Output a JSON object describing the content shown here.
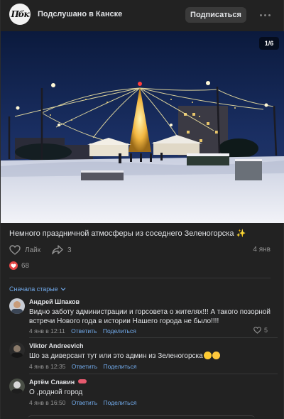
{
  "header": {
    "avatar_text": "Пбк",
    "title": "Подслушано в Канске",
    "subscribe_label": "Подписаться"
  },
  "photo": {
    "counter": "1/6"
  },
  "post": {
    "text": "Немного праздничной атмосферы из соседнего Зеленогорска ✨",
    "like_label": "Лайк",
    "share_count": "3",
    "date": "4 янв",
    "reactions_count": "68"
  },
  "comments_section": {
    "sort_label": "Сначала старые",
    "comments": [
      {
        "author": "Андрей Шпаков",
        "text": "Видно заботу администрации и горсовета о жителях!!! А такого позорной встречи Нового года в истории Нашего города не было!!!!",
        "time": "4 янв в 12:11",
        "reply": "Ответить",
        "share": "Поделиться",
        "likes": "5"
      },
      {
        "author": "Viktor Andreevich",
        "text": "Шо за диверсант тут или это админ из Зеленогорска",
        "time": "4 янв в 12:35",
        "reply": "Ответить",
        "share": "Поделиться"
      },
      {
        "author": "Артём Славин",
        "text": "О ,родной город",
        "time": "4 янв в 16:50",
        "reply": "Ответить",
        "share": "Поделиться"
      }
    ]
  },
  "colors": {
    "background": "#222222",
    "accent": "#71aaeb",
    "reaction": "#e64646"
  }
}
